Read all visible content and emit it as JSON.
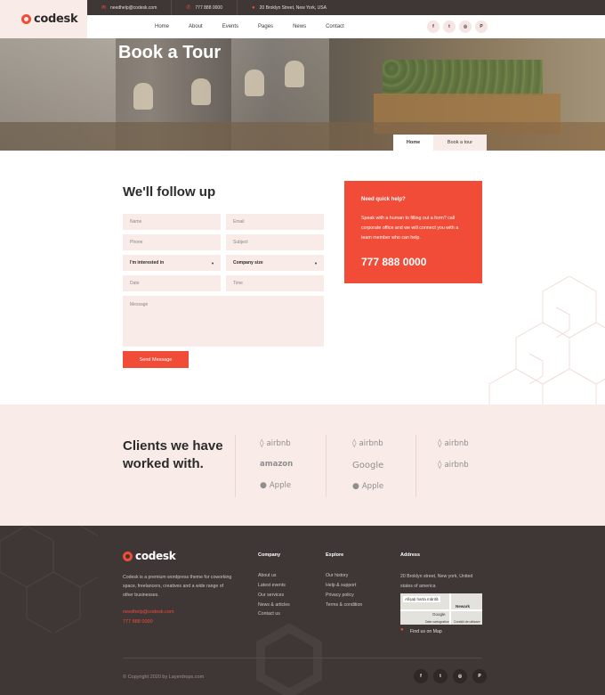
{
  "brand": {
    "name": "codesk"
  },
  "topbar": {
    "email": "needhelp@codesk.com",
    "phone": "777 888 0000",
    "address": "20 Broklyn Street, New York, USA"
  },
  "nav": {
    "items": [
      "Home",
      "About",
      "Events",
      "Pages",
      "News",
      "Contact"
    ]
  },
  "social": {
    "icons": [
      "facebook-icon",
      "twitter-icon",
      "instagram-icon",
      "pinterest-icon"
    ],
    "labels": [
      "f",
      "t",
      "◎",
      "P"
    ]
  },
  "hero": {
    "title": "Book a Tour"
  },
  "breadcrumb": {
    "home": "Home",
    "current": "Book a tour"
  },
  "form": {
    "title": "We'll follow up",
    "name_placeholder": "Name",
    "email_placeholder": "Email",
    "phone_placeholder": "Phone",
    "subject_placeholder": "Subject",
    "interest_value": "I'm interested in",
    "size_value": "Company size",
    "date_placeholder": "Date",
    "time_placeholder": "Time",
    "message_placeholder": "Message",
    "submit_label": "Send Message"
  },
  "help": {
    "title": "Need quick help?",
    "text": "Speak with a human to filling out a form? call corporate office and we will connect you with a team member who can help.",
    "phone": "777 888 0000"
  },
  "clients": {
    "title": "Clients we have worked with.",
    "col1": [
      "airbnb",
      "amazon",
      "Apple"
    ],
    "col2": [
      "airbnb",
      "Google",
      "Apple"
    ],
    "col3": [
      "airbnb",
      "airbnb"
    ]
  },
  "footer": {
    "brand": "codesk",
    "about": "Codesk is a premium wordpress theme for coworking space, freelancers, creatives and a wide range of other businesses.",
    "email": "needhelp@codesk.com",
    "phone": "777 888 0000",
    "company_title": "Company",
    "company_links": [
      "About us",
      "Latest events",
      "Our services",
      "News & articles",
      "Contact us"
    ],
    "explore_title": "Explore",
    "explore_links": [
      "Our history",
      "Help & support",
      "Privacy policy",
      "Terms & condition"
    ],
    "address_title": "Address",
    "address_text": "20 Broklyn street, New york, United states of america",
    "map_labels": [
      "Afișați harta mărită",
      "Newark",
      "Google",
      "Date cartografice",
      "Condiții de utilizare"
    ],
    "map_link": "Find us on Map",
    "copyright": "© Copyright 2020 by Layerdrops.com"
  },
  "colors": {
    "accent": "#f14c38",
    "dark": "#3f3736",
    "pale": "#f9ebe8"
  }
}
